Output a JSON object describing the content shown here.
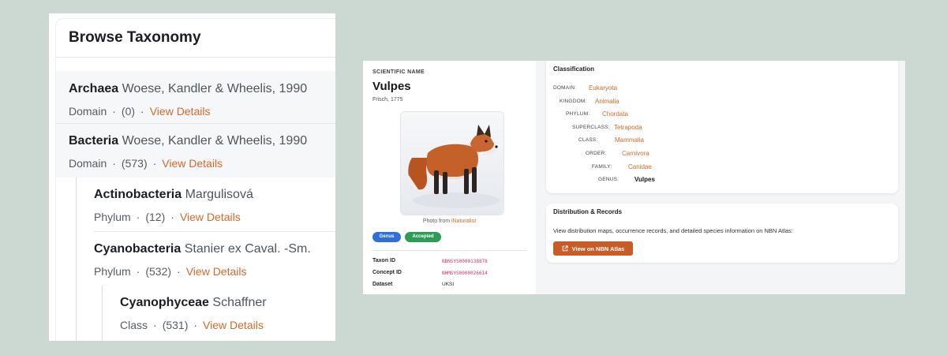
{
  "taxonomy": {
    "title": "Browse Taxonomy",
    "items": [
      {
        "name": "Archaea",
        "author": "Woese, Kandler & Wheelis, 1990",
        "rank": "Domain",
        "count": "(0)",
        "link": "View Details"
      },
      {
        "name": "Bacteria",
        "author": "Woese, Kandler & Wheelis, 1990",
        "rank": "Domain",
        "count": "(573)",
        "link": "View Details"
      },
      {
        "name": "Actinobacteria",
        "author": "Margulisová",
        "rank": "Phylum",
        "count": "(12)",
        "link": "View Details"
      },
      {
        "name": "Cyanobacteria",
        "author": "Stanier ex Caval. -Sm.",
        "rank": "Phylum",
        "count": "(532)",
        "link": "View Details"
      },
      {
        "name": "Cyanophyceae",
        "author": "Schaffner",
        "rank": "Class",
        "count": "(531)",
        "link": "View Details"
      }
    ],
    "dot": "·"
  },
  "species": {
    "label": "SCIENTIFIC NAME",
    "name": "Vulpes",
    "author": "Frisch, 1775",
    "photo_prefix": "Photo from ",
    "photo_source": "iNaturalist",
    "badges": {
      "genus": "Genus",
      "accepted": "Accepted"
    },
    "ids": [
      {
        "label": "Taxon ID",
        "value": "NBNSYS0000138878"
      },
      {
        "label": "Concept ID",
        "value": "NHMSYS0000026614"
      },
      {
        "label": "Dataset",
        "value": "UKSI"
      }
    ]
  },
  "classification": {
    "title": "Classification",
    "ranks": [
      {
        "label": "DOMAIN:",
        "value": "Eukaryota"
      },
      {
        "label": "KINGDOM:",
        "value": "Animalia"
      },
      {
        "label": "PHYLUM:",
        "value": "Chordata"
      },
      {
        "label": "SUPERCLASS:",
        "value": "Tetrapoda"
      },
      {
        "label": "CLASS:",
        "value": "Mammalia"
      },
      {
        "label": "ORDER:",
        "value": "Carnivora"
      },
      {
        "label": "FAMILY:",
        "value": "Canidae"
      },
      {
        "label": "GENUS:",
        "value": "Vulpes"
      }
    ]
  },
  "distribution": {
    "title": "Distribution & Records",
    "text": "View distribution maps, occurrence records, and detailed species information on NBN Atlas:",
    "button": "View on NBN Atlas"
  },
  "colors": {
    "accent": "#d2692c",
    "button": "#c75c26",
    "genus_badge": "#2f6fdc",
    "accepted_badge": "#2e9c56",
    "id_value": "#d1346e"
  }
}
